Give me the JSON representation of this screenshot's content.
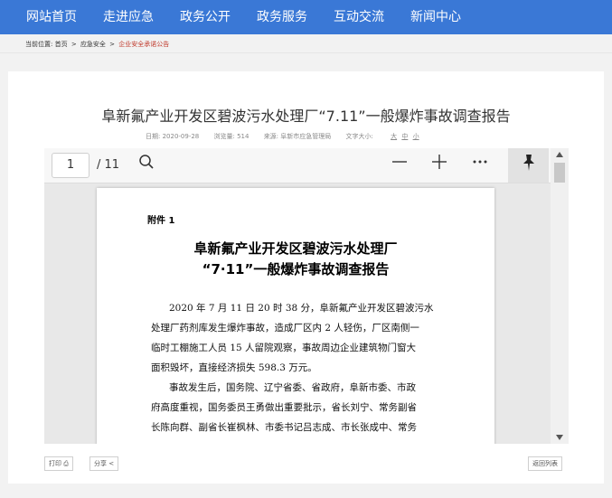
{
  "nav": {
    "items": [
      "网站首页",
      "走进应急",
      "政务公开",
      "政务服务",
      "互动交流",
      "新闻中心"
    ]
  },
  "breadcrumb": {
    "prefix": "当前位置:",
    "items": [
      "首页",
      "应急安全"
    ],
    "current": "企业安全承诺公告",
    "separator": ">"
  },
  "article": {
    "title": "阜新氟产业开发区碧波污水处理厂“7.11”一般爆炸事故调查报告",
    "date": "日期: 2020-09-28",
    "views": "浏览量: 514",
    "source": "来源: 阜新市应急管理局",
    "font_size_label": "文字大小:",
    "font_sizes": [
      "大",
      "中",
      "小"
    ]
  },
  "viewer": {
    "page_input": "1",
    "page_total": "/ 11",
    "icons": {
      "search": "search-icon",
      "zoom_out": "minus-icon",
      "zoom_in": "plus-icon",
      "more": "more-icon",
      "pin": "pin-icon"
    },
    "document": {
      "attachment": "附件 1",
      "title_line1": "阜新氟产业开发区碧波污水处理厂",
      "title_line2": "“7·11”一般爆炸事故调查报告",
      "lines": [
        "2020 年 7 月 11 日 20 时 38 分，阜新氟产业开发区碧波污水",
        "处理厂药剂库发生爆炸事故，造成厂区内 2 人轻伤，厂区南侧一",
        "临时工棚施工人员 15 人留院观察，事故周边企业建筑物门窗大",
        "面积毁坏，直接经济损失 598.3 万元。",
        "事故发生后，国务院、辽宁省委、省政府，阜新市委、市政",
        "府高度重视，国务委员王勇做出重要批示，省长刘宁、常务副省",
        "长陈向群、副省长崔枫林、市委书记吕志成、市长张成中、常务"
      ]
    }
  },
  "footer": {
    "print": "打印",
    "share": "分享",
    "back": "返回列表"
  }
}
